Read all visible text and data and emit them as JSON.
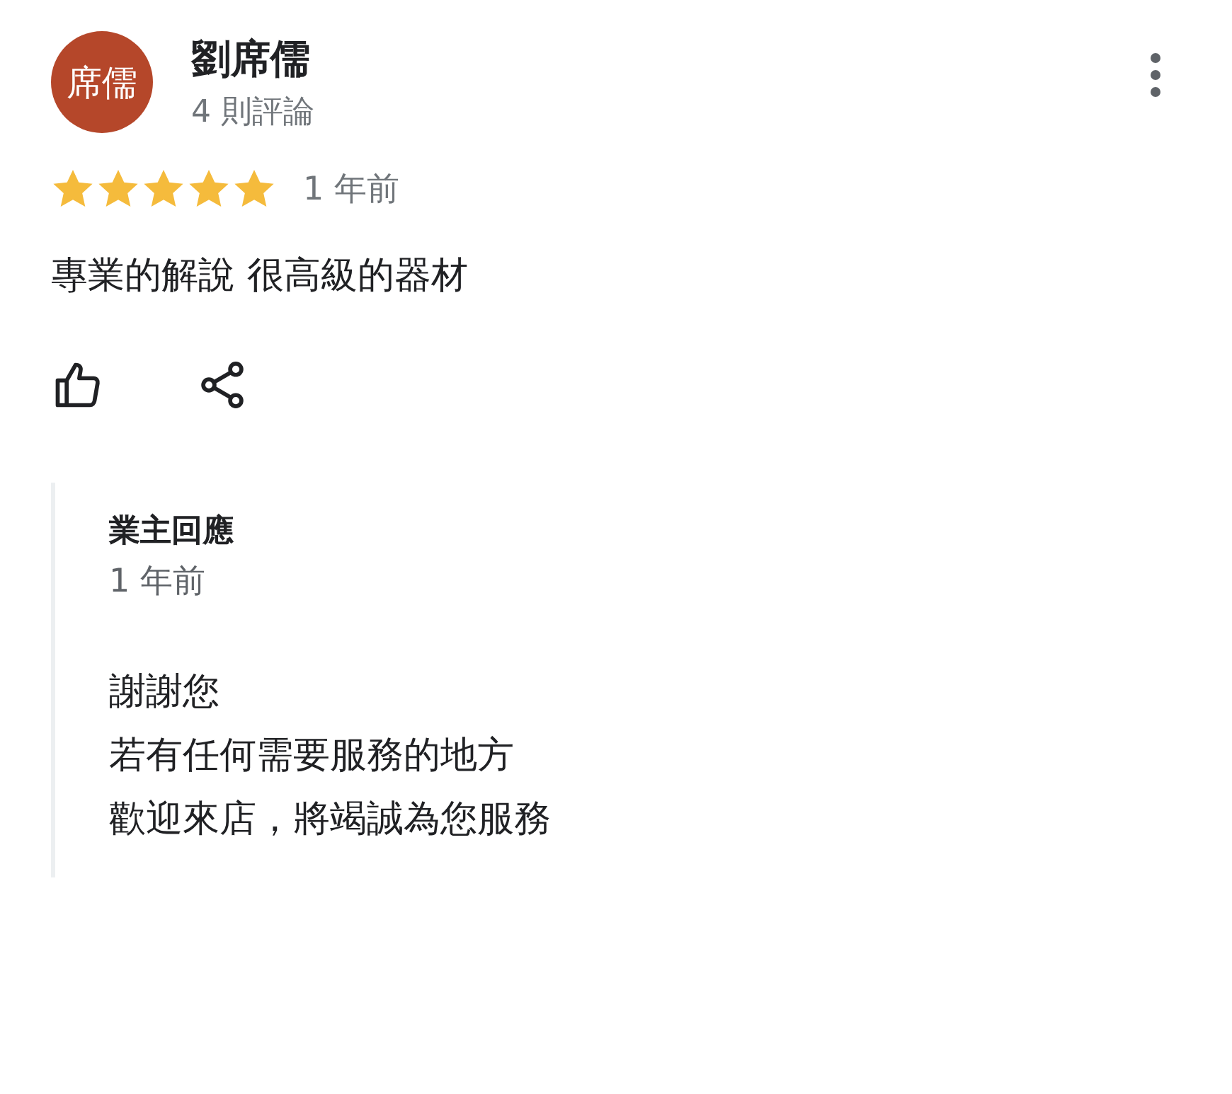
{
  "review": {
    "avatar": {
      "text": "席儒",
      "color": "#b5472a"
    },
    "author": "劉席儒",
    "review_count": "4 則評論",
    "stars": 5,
    "time": "1 年前",
    "text": "專業的解說 很高級的器材"
  },
  "owner_reply": {
    "title": "業主回應",
    "time": "1 年前",
    "lines": [
      "謝謝您",
      "若有任何需要服務的地方",
      "歡迎來店，將竭誠為您服務"
    ]
  }
}
